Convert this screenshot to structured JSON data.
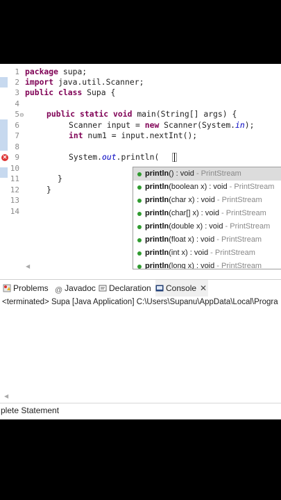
{
  "editor": {
    "lines": [
      {
        "num": "1"
      },
      {
        "num": "2"
      },
      {
        "num": "3"
      },
      {
        "num": "4"
      },
      {
        "num": "5"
      },
      {
        "num": "6"
      },
      {
        "num": "7"
      },
      {
        "num": "8"
      },
      {
        "num": "9"
      },
      {
        "num": "10"
      },
      {
        "num": "11"
      },
      {
        "num": "12"
      },
      {
        "num": "13"
      },
      {
        "num": "14"
      }
    ],
    "code": {
      "l1_kw": "package",
      "l1_rest": " supa;",
      "l2_kw": "import",
      "l2_rest": " java.util.Scanner;",
      "l3_kw1": "public",
      "l3_kw2": "class",
      "l3_rest": " Supa {",
      "l5_kw1": "public",
      "l5_kw2": "static",
      "l5_kw3": "void",
      "l5_rest": " main(String[] args) {",
      "l6_a": "Scanner input = ",
      "l6_kw": "new",
      "l6_b": " Scanner(System.",
      "l6_fld": "in",
      "l6_c": ");",
      "l7_kw": "int",
      "l7_rest": " num1 = input.nextInt();",
      "l9_a": "System.",
      "l9_fld": "out",
      "l9_b": ".println(",
      "l11": "}",
      "l12": "}"
    }
  },
  "popup": {
    "items": [
      {
        "sig": "println",
        "rest": "() : void",
        "owner": " - PrintStream"
      },
      {
        "sig": "println",
        "rest": "(boolean x) : void",
        "owner": " - PrintStream"
      },
      {
        "sig": "println",
        "rest": "(char x) : void",
        "owner": " - PrintStream"
      },
      {
        "sig": "println",
        "rest": "(char[] x) : void",
        "owner": " - PrintStream"
      },
      {
        "sig": "println",
        "rest": "(double x) : void",
        "owner": " - PrintStream"
      },
      {
        "sig": "println",
        "rest": "(float x) : void",
        "owner": " - PrintStream"
      },
      {
        "sig": "println",
        "rest": "(int x) : void",
        "owner": " - PrintStream"
      },
      {
        "sig": "println",
        "rest": "(long x) : void",
        "owner": " - PrintStream"
      }
    ]
  },
  "panel": {
    "tabs": {
      "problems": "Problems",
      "javadoc": "Javadoc",
      "declaration": "Declaration",
      "console": "Console"
    },
    "console_status": "<terminated> Supa [Java Application] C:\\Users\\Supanu\\AppData\\Local\\Progra",
    "status_line": "plete Statement"
  },
  "colors": {
    "keyword": "#7f0055",
    "field": "#0000c0",
    "occurrence": "#c7d9ef",
    "selection": "#dcdcdc"
  }
}
